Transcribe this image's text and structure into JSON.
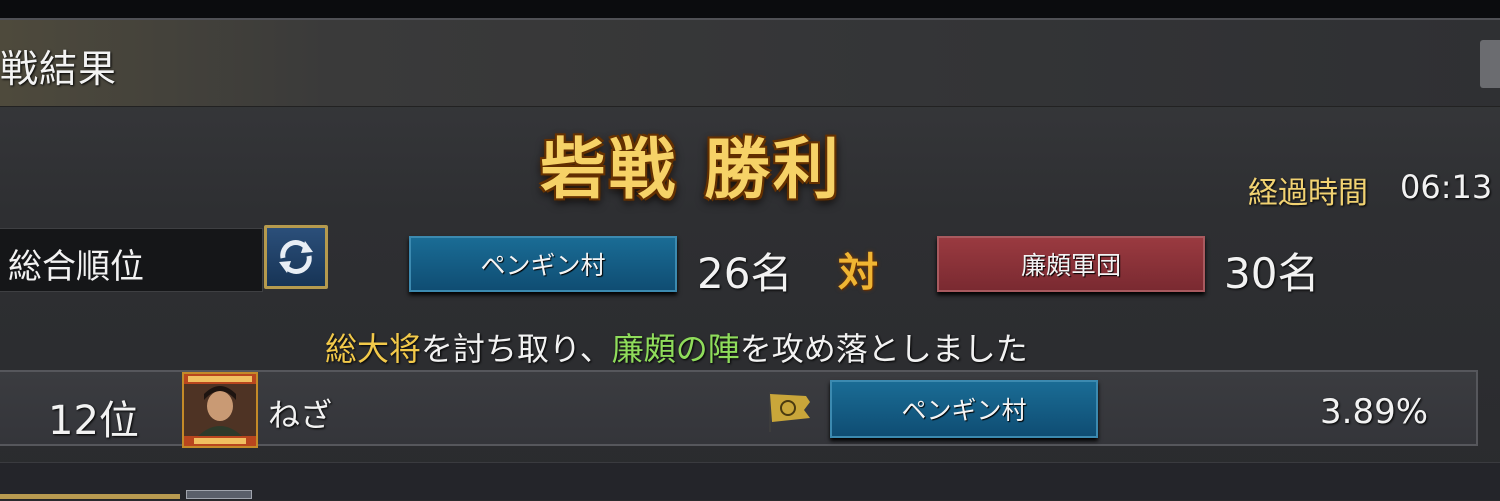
{
  "header": {
    "title": "戦結果"
  },
  "result": {
    "title": "砦戦 勝利",
    "elapsed_label": "経過時間",
    "elapsed_value": "06:13"
  },
  "ranking": {
    "label": "総合順位",
    "refresh_icon": "refresh-icon"
  },
  "teams": {
    "left": {
      "name": "ペンギン村",
      "count": "26名",
      "color": "#125a86"
    },
    "versus": "対",
    "right": {
      "name": "廉頗軍団",
      "count": "30名",
      "color": "#8c3439"
    }
  },
  "message": {
    "part1": "総大将",
    "part2": "を討ち取り、",
    "part3": "廉頗の陣",
    "part4": "を攻め落としました"
  },
  "rows": [
    {
      "rank": "12位",
      "name": "ねざ",
      "team": "ペンギン村",
      "percent": "3.89%",
      "avatar_icon": "player-portrait-icon",
      "flag_icon": "guild-flag-icon"
    }
  ]
}
